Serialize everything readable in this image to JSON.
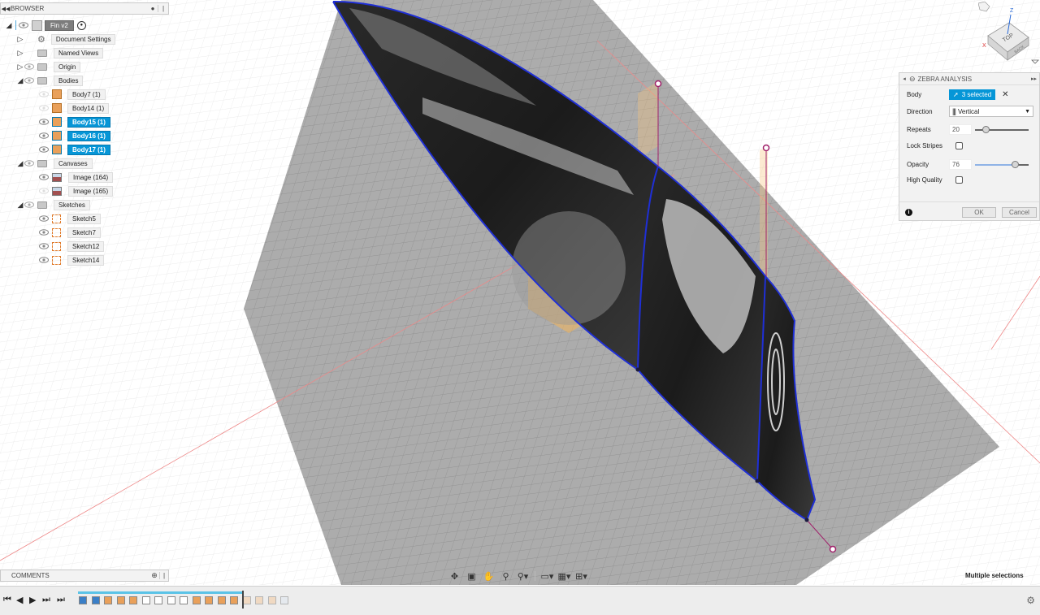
{
  "browser": {
    "title": "BROWSER",
    "root": "Fin v2",
    "items": [
      {
        "label": "Document Settings"
      },
      {
        "label": "Named Views"
      },
      {
        "label": "Origin"
      },
      {
        "label": "Bodies"
      },
      {
        "label": "Body7 (1)"
      },
      {
        "label": "Body14 (1)"
      },
      {
        "label": "Body15 (1)"
      },
      {
        "label": "Body16 (1)"
      },
      {
        "label": "Body17 (1)"
      },
      {
        "label": "Canvases"
      },
      {
        "label": "Image (164)"
      },
      {
        "label": "Image (165)"
      },
      {
        "label": "Sketches"
      },
      {
        "label": "Sketch5"
      },
      {
        "label": "Sketch7"
      },
      {
        "label": "Sketch12"
      },
      {
        "label": "Sketch14"
      }
    ],
    "selected": [
      "Body15 (1)",
      "Body16 (1)",
      "Body17 (1)"
    ]
  },
  "zebra": {
    "title": "ZEBRA ANALYSIS",
    "body_label": "Body",
    "selection_text": "3 selected",
    "direction_label": "Direction",
    "direction_value": "Vertical",
    "repeats_label": "Repeats",
    "repeats_value": "20",
    "lock_stripes_label": "Lock Stripes",
    "opacity_label": "Opacity",
    "opacity_value": "76",
    "high_quality_label": "High Quality",
    "ok_label": "OK",
    "cancel_label": "Cancel"
  },
  "viewcube": {
    "top": "TOP",
    "back": "BACK",
    "axes": {
      "x": "X",
      "z": "Z"
    }
  },
  "comments": {
    "title": "COMMENTS"
  },
  "status": {
    "selection": "Multiple selections"
  },
  "nav_icons": [
    "orbit-icon",
    "look-at-icon",
    "pan-icon",
    "zoom-icon",
    "zoom-window-icon",
    "display-settings-icon",
    "grid-icon",
    "viewports-icon"
  ],
  "timeline": {
    "controls": [
      "first",
      "previous",
      "play",
      "next",
      "last"
    ],
    "playhead": 0.92
  }
}
